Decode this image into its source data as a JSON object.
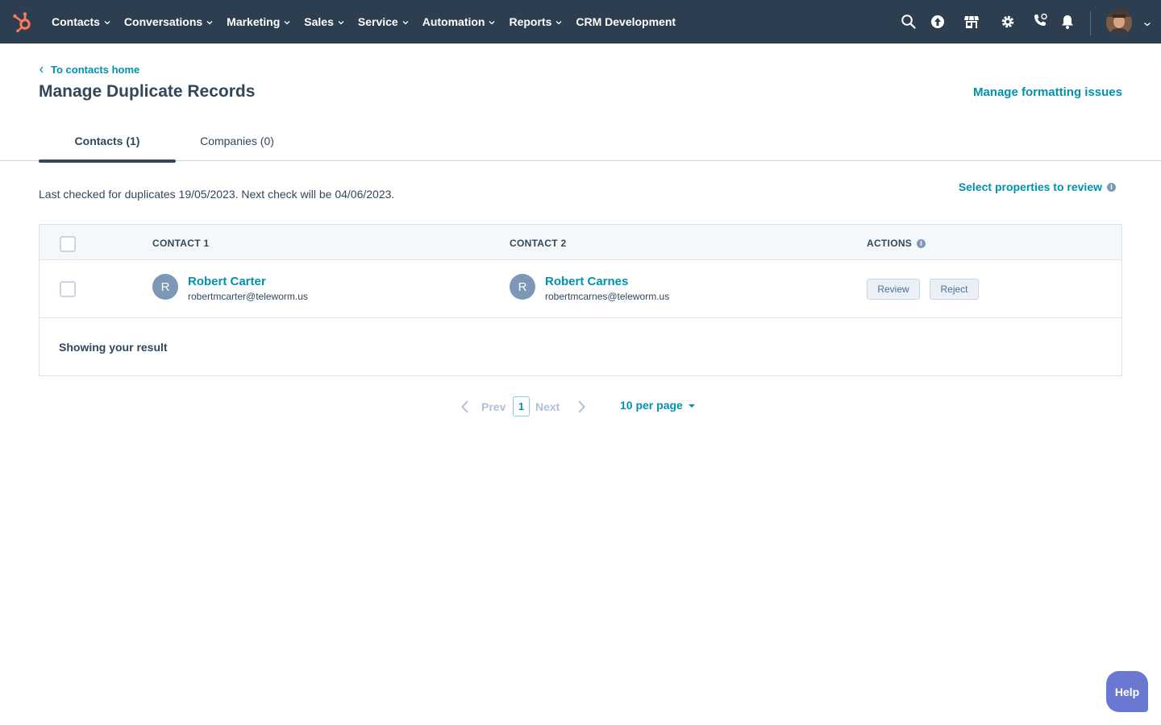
{
  "topnav": {
    "items": [
      {
        "label": "Contacts",
        "dropdown": true
      },
      {
        "label": "Conversations",
        "dropdown": true
      },
      {
        "label": "Marketing",
        "dropdown": true
      },
      {
        "label": "Sales",
        "dropdown": true
      },
      {
        "label": "Service",
        "dropdown": true
      },
      {
        "label": "Automation",
        "dropdown": true
      },
      {
        "label": "Reports",
        "dropdown": true
      },
      {
        "label": "CRM Development",
        "dropdown": false
      }
    ],
    "icons": [
      "search-icon",
      "upgrade-icon",
      "marketplace-icon",
      "settings-icon",
      "calling-icon",
      "notifications-icon"
    ],
    "brand_color": "#ff7a59",
    "background": "#2d3e50"
  },
  "header": {
    "back_link": "To contacts home",
    "title": "Manage Duplicate Records",
    "format_link": "Manage formatting issues"
  },
  "tabs": [
    {
      "label": "Contacts (1)",
      "active": true
    },
    {
      "label": "Companies (0)",
      "active": false
    }
  ],
  "status": {
    "last_checked": "Last checked for duplicates 19/05/2023. Next check will be 04/06/2023.",
    "select_properties": "Select properties to review"
  },
  "table": {
    "columns": [
      "CONTACT 1",
      "CONTACT 2",
      "ACTIONS"
    ],
    "rows": [
      {
        "contact1": {
          "initial": "R",
          "name": "Robert Carter",
          "email": "robertmcarter@teleworm.us"
        },
        "contact2": {
          "initial": "R",
          "name": "Robert Carnes",
          "email": "robertmcarnes@teleworm.us"
        },
        "actions": [
          "Review",
          "Reject"
        ]
      }
    ],
    "footer": "Showing your result"
  },
  "pagination": {
    "prev": "Prev",
    "current": "1",
    "next": "Next",
    "per_page": "10 per page"
  },
  "help": {
    "label": "Help"
  },
  "accent_color": "#0091ae"
}
